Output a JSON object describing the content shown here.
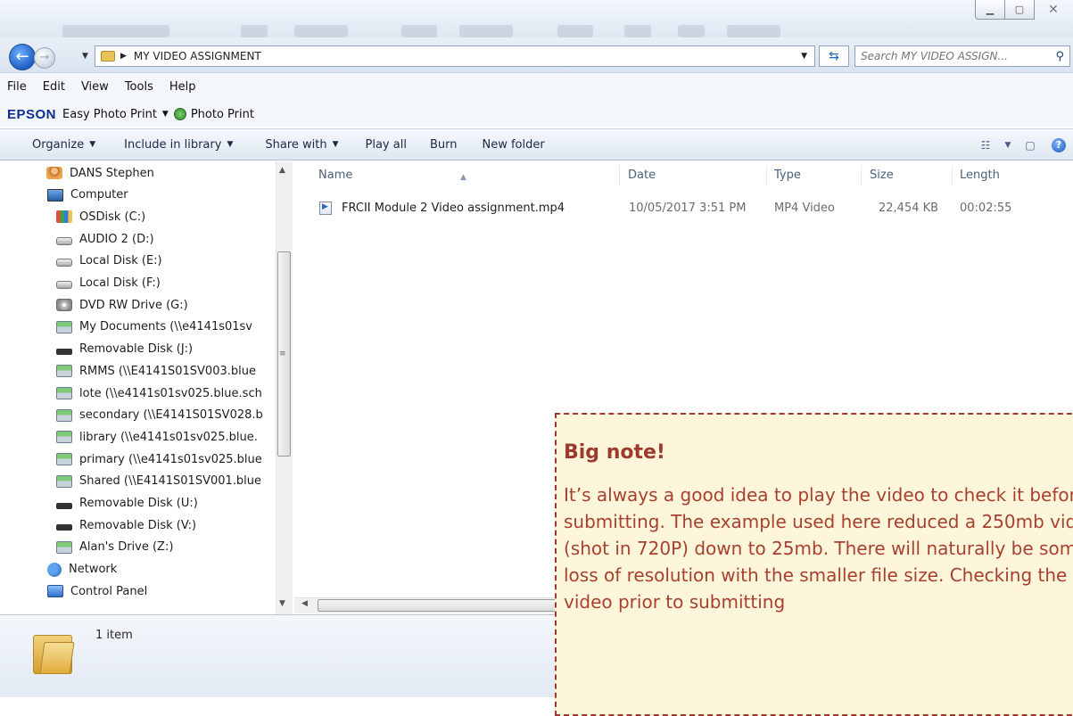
{
  "window": {
    "controls": [
      "minimize",
      "maximize",
      "close"
    ],
    "close_glyph": "✕"
  },
  "address_bar": {
    "path": "MY VIDEO ASSIGNMENT",
    "search_placeholder": "Search MY VIDEO ASSIGN..."
  },
  "menu": [
    "File",
    "Edit",
    "View",
    "Tools",
    "Help"
  ],
  "epson_bar": {
    "logo": "EPSON",
    "easy_photo_print": "Easy Photo Print",
    "photo_print": "Photo Print"
  },
  "command_bar": {
    "organize": "Organize",
    "include_in_library": "Include in library",
    "share_with": "Share with",
    "play_all": "Play all",
    "burn": "Burn",
    "new_folder": "New folder"
  },
  "nav": {
    "items": [
      {
        "label": "DANS Stephen",
        "icon": "user-folder-icon"
      },
      {
        "label": "Computer",
        "icon": "computer-icon"
      },
      {
        "label": "OSDisk (C:)",
        "icon": "os-disk-icon"
      },
      {
        "label": "AUDIO 2 (D:)",
        "icon": "drive-icon"
      },
      {
        "label": "Local Disk (E:)",
        "icon": "drive-icon"
      },
      {
        "label": "Local Disk (F:)",
        "icon": "drive-icon"
      },
      {
        "label": "DVD RW Drive (G:)",
        "icon": "dvd-drive-icon"
      },
      {
        "label": "My Documents (\\\\e4141s01sv",
        "icon": "network-drive-icon"
      },
      {
        "label": "Removable Disk (J:)",
        "icon": "removable-disk-icon"
      },
      {
        "label": "RMMS (\\\\E4141S01SV003.blue",
        "icon": "network-drive-icon"
      },
      {
        "label": "lote (\\\\e4141s01sv025.blue.sch",
        "icon": "network-drive-icon"
      },
      {
        "label": "secondary (\\\\E4141S01SV028.b",
        "icon": "network-drive-icon"
      },
      {
        "label": "library (\\\\e4141s01sv025.blue.",
        "icon": "network-drive-icon"
      },
      {
        "label": "primary (\\\\e4141s01sv025.blue",
        "icon": "network-drive-icon"
      },
      {
        "label": "Shared (\\\\E4141S01SV001.blue",
        "icon": "network-drive-icon"
      },
      {
        "label": "Removable Disk (U:)",
        "icon": "removable-disk-icon"
      },
      {
        "label": "Removable Disk (V:)",
        "icon": "removable-disk-icon"
      },
      {
        "label": "Alan's Drive (Z:)",
        "icon": "network-drive-icon"
      },
      {
        "label": "Network",
        "icon": "network-icon"
      },
      {
        "label": "Control Panel",
        "icon": "control-panel-icon"
      }
    ]
  },
  "columns": {
    "name": "Name",
    "date": "Date",
    "type": "Type",
    "size": "Size",
    "length": "Length"
  },
  "files": [
    {
      "name": "FRCII Module 2 Video assignment.mp4",
      "date": "10/05/2017 3:51 PM",
      "type": "MP4 Video",
      "size": "22,454 KB",
      "length": "00:02:55"
    }
  ],
  "details": {
    "count": "1 item"
  },
  "note": {
    "title": "Big note!",
    "body": "It’s always a good idea to play the video to check it before submitting. The example used here reduced a 250mb video (shot in 720P) down to 25mb. There will naturally be some loss of resolution with the smaller file size. Checking the video prior to submitting"
  }
}
